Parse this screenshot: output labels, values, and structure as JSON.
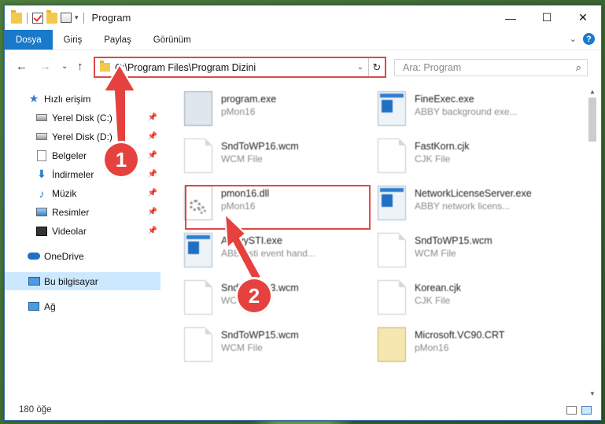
{
  "window": {
    "title": "Program"
  },
  "title_controls": {
    "minimize": "—",
    "maximize": "☐",
    "close": "✕"
  },
  "ribbon": {
    "tabs": [
      "Dosya",
      "Giriş",
      "Paylaş",
      "Görünüm"
    ],
    "collapse_icon": "chevron-down-icon",
    "help_label": "?"
  },
  "address": {
    "path": "C:\\Program Files\\Program Dizini",
    "search_placeholder": "Ara: Program"
  },
  "nav": {
    "items": [
      {
        "label": "Hızlı erişim",
        "icon": "star-icon",
        "pinned": false
      },
      {
        "label": "Yerel Disk (C:)",
        "icon": "disk-icon",
        "pinned": true
      },
      {
        "label": "Yerel Disk (D:)",
        "icon": "disk-icon",
        "pinned": true
      },
      {
        "label": "Belgeler",
        "icon": "documents-icon",
        "pinned": true
      },
      {
        "label": "İndirmeler",
        "icon": "downloads-icon",
        "pinned": true
      },
      {
        "label": "Müzik",
        "icon": "music-icon",
        "pinned": true
      },
      {
        "label": "Resimler",
        "icon": "pictures-icon",
        "pinned": true
      },
      {
        "label": "Videolar",
        "icon": "videos-icon",
        "pinned": true
      },
      {
        "label": "OneDrive",
        "icon": "cloud-icon",
        "pinned": false
      },
      {
        "label": "Bu bilgisayar",
        "icon": "computer-icon",
        "pinned": false,
        "selected": true
      },
      {
        "label": "Ağ",
        "icon": "network-icon",
        "pinned": false
      }
    ]
  },
  "files": [
    {
      "name": "program.exe",
      "type": "pMon16",
      "icon": "installer-icon"
    },
    {
      "name": "FineExec.exe",
      "type": "ABBY background exe...",
      "icon": "app-icon"
    },
    {
      "name": "SndToWP16.wcm",
      "type": "WCM File",
      "icon": "file-icon"
    },
    {
      "name": "FastKorn.cjk",
      "type": "CJK File",
      "icon": "file-icon"
    },
    {
      "name": "pmon16.dll",
      "type": "pMon16",
      "icon": "dll-gear-icon"
    },
    {
      "name": "NetworkLicenseServer.exe",
      "type": "ABBY network licens...",
      "icon": "app-icon"
    },
    {
      "name": "AbbyySTI.exe",
      "type": "ABBY sti event hand...",
      "icon": "app-icon"
    },
    {
      "name": "SndToWP15.wcm",
      "type": "WCM File",
      "icon": "file-icon"
    },
    {
      "name": "SndToWP13.wcm",
      "type": "WCM File",
      "icon": "file-icon"
    },
    {
      "name": "Korean.cjk",
      "type": "CJK File",
      "icon": "file-icon"
    },
    {
      "name": "SndToWP15.wcm",
      "type": "WCM File",
      "icon": "file-icon"
    },
    {
      "name": "Microsoft.VC90.CRT",
      "type": "pMon16",
      "icon": "crt-folder-icon"
    }
  ],
  "status": {
    "count": "180 öğe"
  },
  "callouts": {
    "step1": "1",
    "step2": "2"
  },
  "colors": {
    "accent": "#1979ca",
    "highlight_red": "#e04848",
    "badge_red": "#e5413e",
    "selected_bg": "#cce8ff"
  }
}
